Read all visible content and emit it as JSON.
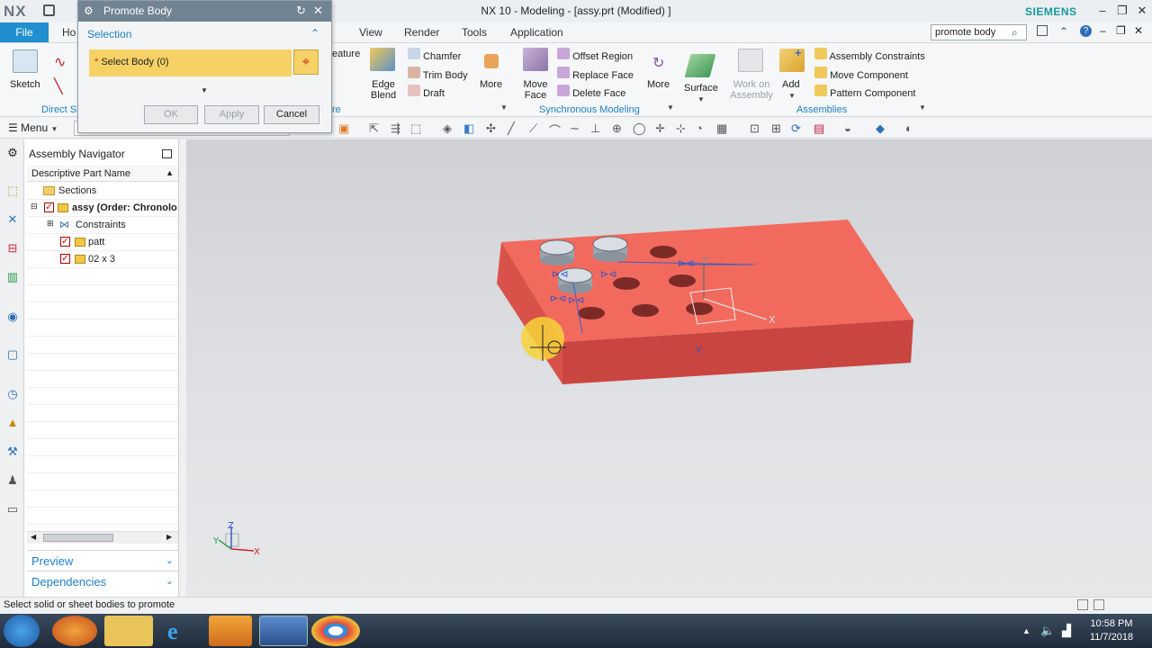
{
  "titlebar": {
    "logo": "NX",
    "title": "NX 10 - Modeling - [assy.prt (Modified) ]",
    "brand": "SIEMENS"
  },
  "menu": {
    "file": "File",
    "home_partial": "Ho",
    "tabs": [
      "View",
      "Render",
      "Tools",
      "Application"
    ],
    "search_value": "promote body"
  },
  "ribbon": {
    "sketch": "Sketch",
    "direct_sketch_partial": "Direct Sk",
    "feature_partial": "eature",
    "feature_group_partial": "re",
    "edge_blend": "Edge Blend",
    "chamfer": "Chamfer",
    "trim_body": "Trim Body",
    "draft": "Draft",
    "more1": "More",
    "move_face": "Move Face",
    "offset_region": "Offset Region",
    "replace_face": "Replace Face",
    "delete_face": "Delete Face",
    "more2": "More",
    "sync_group": "Synchronous Modeling",
    "surface": "Surface",
    "work_on_assembly": "Work on Assembly",
    "add": "Add",
    "assembly_constraints": "Assembly Constraints",
    "move_component": "Move Component",
    "pattern_component": "Pattern Component",
    "assemblies_group": "Assemblies"
  },
  "toolbar": {
    "menu": "Menu"
  },
  "dialog": {
    "title": "Promote Body",
    "section": "Selection",
    "select_body": "Select Body (0)",
    "ok": "OK",
    "apply": "Apply",
    "cancel": "Cancel"
  },
  "navigator": {
    "title": "Assembly Navigator",
    "column": "Descriptive Part Name",
    "items": [
      {
        "label": "Sections"
      },
      {
        "label": "assy (Order: Chronolo"
      },
      {
        "label": "Constraints"
      },
      {
        "label": "patt"
      },
      {
        "label": "02 x 3"
      }
    ],
    "preview": "Preview",
    "dependencies": "Dependencies"
  },
  "viewport": {
    "axis_x": "X",
    "axis_y": "Y",
    "axis_z": "Z"
  },
  "status": {
    "prompt": "Select solid or sheet bodies to promote"
  },
  "taskbar": {
    "time": "10:58 PM",
    "date": "11/7/2018"
  },
  "colors": {
    "accent": "#1f8fcf",
    "body": "#f26a5e",
    "selection": "#f6d266"
  }
}
